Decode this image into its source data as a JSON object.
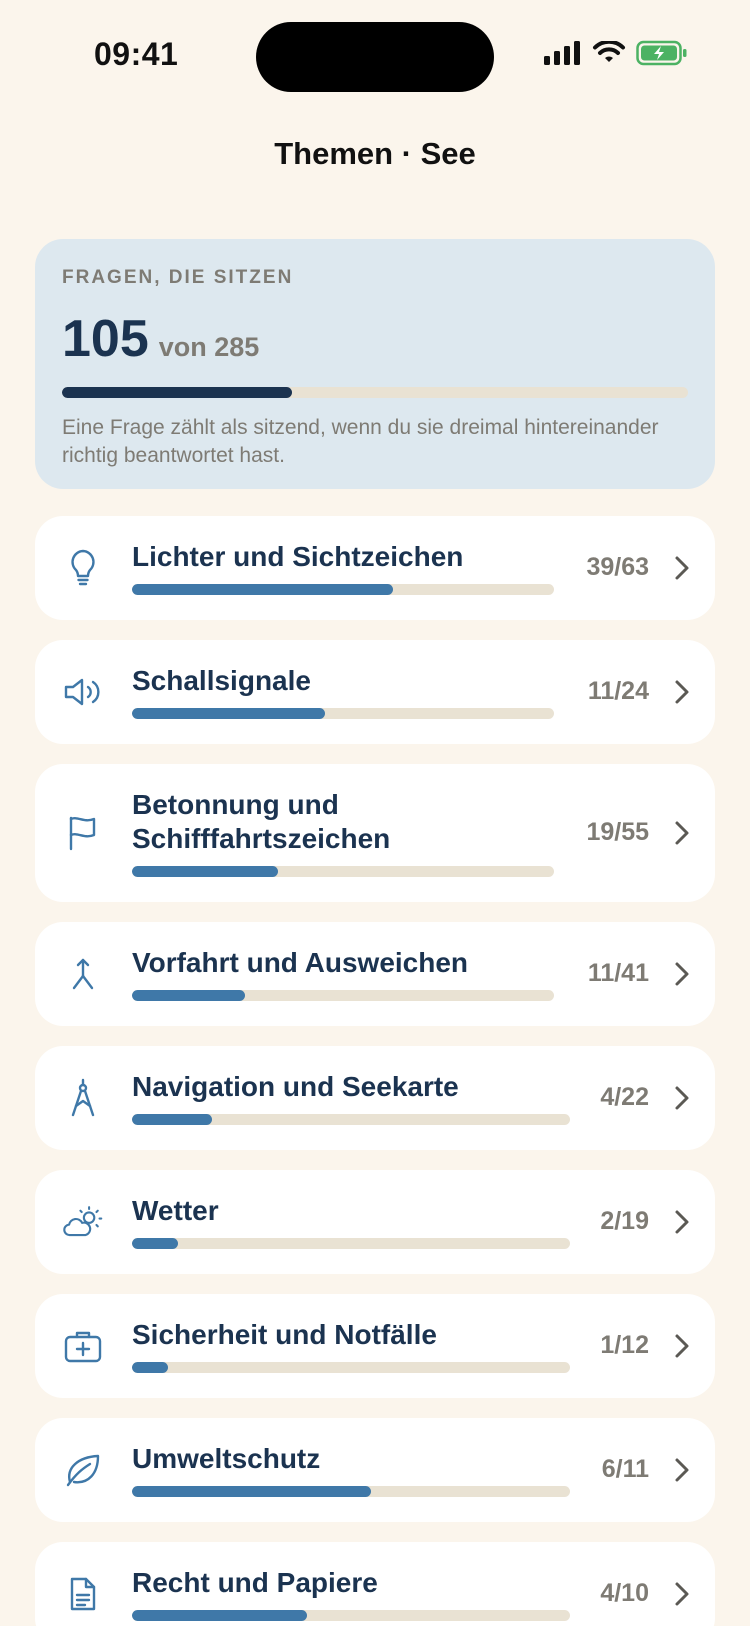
{
  "status": {
    "time": "09:41"
  },
  "header": {
    "title": "Themen · See"
  },
  "summary": {
    "label": "FRAGEN, DIE SITZEN",
    "done": "105",
    "total_text": "von 285",
    "progress": 0.368,
    "note": "Eine Frage zählt als sitzend, wenn du sie dreimal hintereinander richtig beantwortet hast."
  },
  "topics": [
    {
      "title": "Lichter und Sichtzeichen",
      "count": "39/63",
      "progress": 0.619,
      "icon": "lightbulb-icon"
    },
    {
      "title": "Schallsignale",
      "count": "11/24",
      "progress": 0.458,
      "icon": "speaker-icon"
    },
    {
      "title": "Betonnung und Schifffahrtszeichen",
      "count": "19/55",
      "progress": 0.345,
      "icon": "flag-icon"
    },
    {
      "title": "Vorfahrt und Ausweichen",
      "count": "11/41",
      "progress": 0.268,
      "icon": "merge-arrow-icon"
    },
    {
      "title": "Navigation und Seekarte",
      "count": "4/22",
      "progress": 0.182,
      "icon": "compass-icon"
    },
    {
      "title": "Wetter",
      "count": "2/19",
      "progress": 0.105,
      "icon": "weather-icon"
    },
    {
      "title": "Sicherheit und Notfälle",
      "count": "1/12",
      "progress": 0.083,
      "icon": "first-aid-kit-icon"
    },
    {
      "title": "Umweltschutz",
      "count": "6/11",
      "progress": 0.545,
      "icon": "leaf-icon"
    },
    {
      "title": "Recht und Papiere",
      "count": "4/10",
      "progress": 0.4,
      "icon": "document-icon"
    }
  ],
  "colors": {
    "background": "#FBF5EC",
    "summary_bg": "#DDE8EF",
    "navy": "#1B3350",
    "accent": "#3F78A8",
    "track": "#E9E2D3",
    "muted": "#7E7B74"
  }
}
